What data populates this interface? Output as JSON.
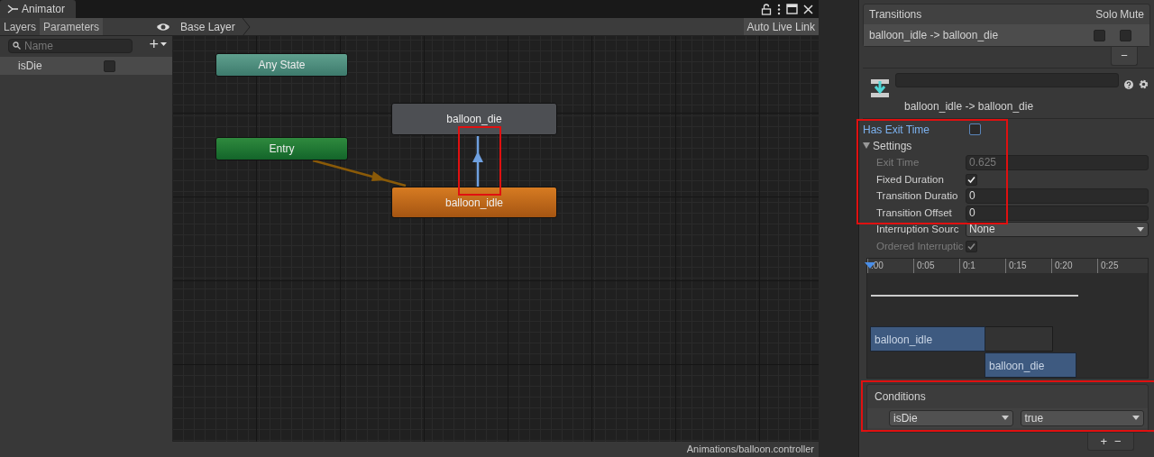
{
  "animator": {
    "tab": "Animator",
    "panel_tabs": [
      {
        "label": "Layers",
        "selected": false
      },
      {
        "label": "Parameters",
        "selected": true
      }
    ],
    "search": {
      "placeholder": "Name"
    },
    "add_button": "+",
    "parameters": [
      {
        "name": "isDie",
        "checked": false
      }
    ],
    "breadcrumb": "Base Layer",
    "live_link_button": "Auto Live Link",
    "graph": {
      "states": [
        {
          "name": "Any State",
          "kind": "any"
        },
        {
          "name": "Entry",
          "kind": "entry"
        },
        {
          "name": "balloon_die",
          "kind": "state"
        },
        {
          "name": "balloon_idle",
          "kind": "default"
        }
      ],
      "transition_highlighted": true
    },
    "status_bar": "Animations/balloon.controller"
  },
  "inspector": {
    "transitions_list": {
      "header": "Transitions",
      "solo_header": "Solo",
      "mute_header": "Mute",
      "rows": [
        {
          "name": "balloon_idle -> balloon_die",
          "solo": false,
          "mute": false,
          "selected": true
        }
      ],
      "remove_button": "−"
    },
    "title": "balloon_idle -> balloon_die",
    "has_exit_time": {
      "label": "Has Exit Time",
      "checked": false
    },
    "settings": {
      "label": "Settings",
      "expanded": true,
      "highlighted": true,
      "fields": [
        {
          "label": "Exit Time",
          "kind": "number",
          "value": "0.625",
          "disabled": true
        },
        {
          "label": "Fixed Duration",
          "kind": "checkbox",
          "checked": true,
          "disabled": false
        },
        {
          "label": "Transition Duratio",
          "kind": "number",
          "value": "0",
          "disabled": false
        },
        {
          "label": "Transition Offset",
          "kind": "number",
          "value": "0",
          "disabled": false
        },
        {
          "label": "Interruption Sourc",
          "kind": "dropdown",
          "value": "None",
          "disabled": false
        },
        {
          "label": "Ordered Interruptic",
          "kind": "checkbox",
          "checked": true,
          "disabled": true
        }
      ]
    },
    "timeline": {
      "ticks": [
        ":00",
        "0:05",
        "0:1",
        "0:15",
        "0:20",
        "0:25"
      ],
      "clips": [
        {
          "name": "balloon_idle"
        },
        {
          "name": "balloon_die"
        }
      ]
    },
    "conditions": {
      "header": "Conditions",
      "highlighted": true,
      "rows": [
        {
          "parameter": "isDie",
          "value": "true"
        }
      ],
      "add_button": "+",
      "remove_button": "−"
    }
  }
}
